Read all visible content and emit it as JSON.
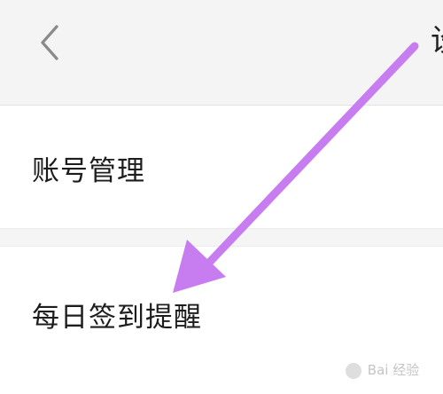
{
  "header": {
    "back_icon": "chevron-left-icon",
    "title_partial": "设"
  },
  "settings": {
    "items": [
      {
        "label": "账号管理"
      },
      {
        "label": "每日签到提醒"
      }
    ]
  },
  "annotation": {
    "arrow_color": "#c77df0",
    "arrow_icon": "pointer-arrow"
  },
  "watermark": {
    "text": "Bai 经验",
    "icon": "paw-icon",
    "color": "#a0a0a0"
  },
  "colors": {
    "header_bg": "#f4f4f4",
    "row_bg": "#ffffff",
    "gap_bg": "#f5f5f5",
    "text": "#1d1d1d"
  }
}
